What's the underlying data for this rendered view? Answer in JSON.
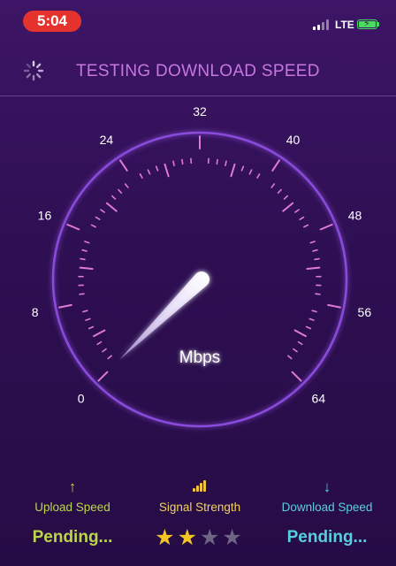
{
  "status_bar": {
    "time": "5:04",
    "network": "LTE",
    "signal_bars_active": 2,
    "signal_bars_total": 4
  },
  "header": {
    "title": "TESTING DOWNLOAD SPEED",
    "spinner_icon": "loading-spinner-icon"
  },
  "gauge": {
    "unit": "Mbps",
    "scale_labels": [
      "0",
      "8",
      "16",
      "24",
      "32",
      "40",
      "48",
      "56",
      "64"
    ],
    "min": 0,
    "max": 64,
    "needle_value": 8,
    "colors": {
      "ring": "#8a4cdc",
      "ticks": "#e07ad8",
      "needle": "#ffffff"
    }
  },
  "stats": {
    "upload": {
      "icon": "upload-arrow-icon",
      "icon_glyph": "↑",
      "label": "Upload Speed",
      "value": "Pending..."
    },
    "signal": {
      "icon": "signal-strength-icon",
      "label": "Signal Strength",
      "rating": 2,
      "rating_max": 4
    },
    "download": {
      "icon": "download-arrow-icon",
      "icon_glyph": "↓",
      "label": "Download Speed",
      "value": "Pending..."
    }
  },
  "colors": {
    "upload": "#bcd64a",
    "signal": "#f2d35a",
    "download": "#58cfe0",
    "title": "#c678e0"
  }
}
